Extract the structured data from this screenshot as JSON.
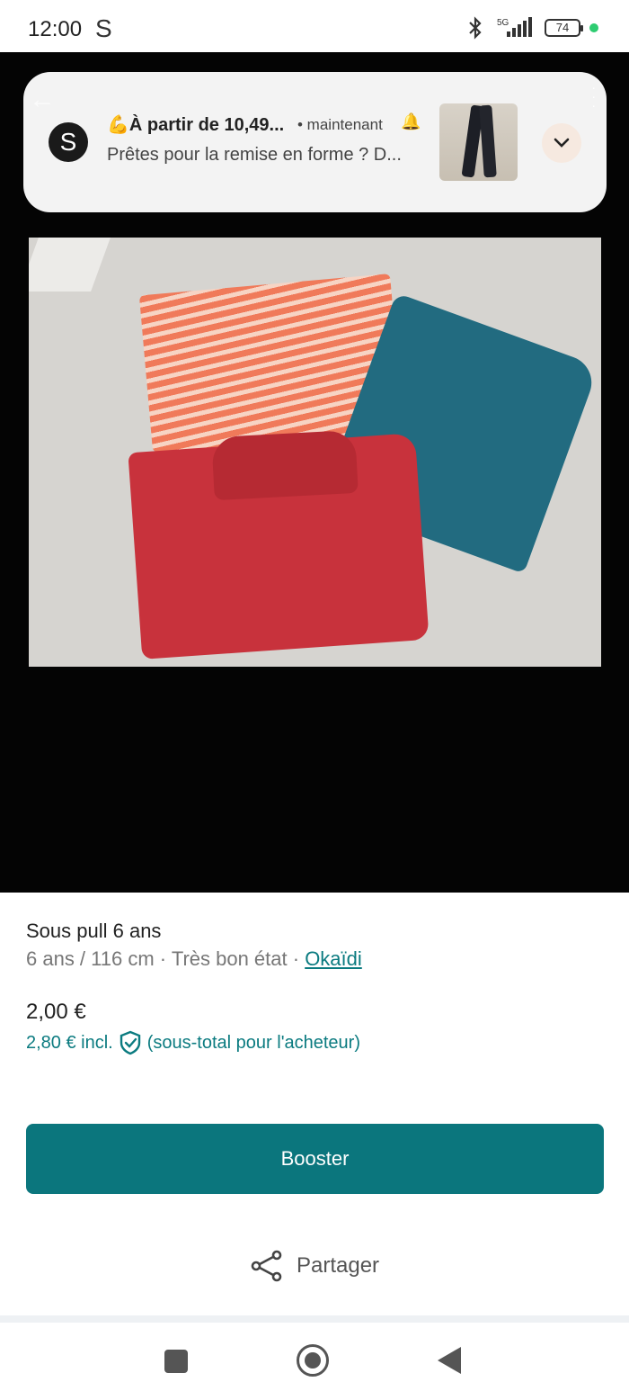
{
  "status_bar": {
    "time": "12:00",
    "app_icon": "S",
    "network": "5G",
    "battery": "74",
    "icons": [
      "bluetooth-icon",
      "signal-icon",
      "battery-icon"
    ]
  },
  "notification": {
    "avatar_letter": "S",
    "title": "💪À partir de 10,49...",
    "time": "• maintenant",
    "body": "Prêtes pour la remise en forme ? D...",
    "icons": [
      "back-arrow-icon",
      "bell-icon",
      "chevron-down-icon",
      "more-icon"
    ]
  },
  "listing": {
    "title": "Sous pull 6 ans",
    "details": "6 ans / 116 cm · Très bon état · ",
    "brand": "Okaïdi",
    "price": "2,00 €",
    "price_incl": "2,80 €  incl.",
    "price_incl_note": "(sous-total pour l'acheteur)"
  },
  "actions": {
    "booster_label": "Booster",
    "share_label": "Partager"
  },
  "colors": {
    "accent": "#0b767d",
    "link": "#0b7b80"
  }
}
